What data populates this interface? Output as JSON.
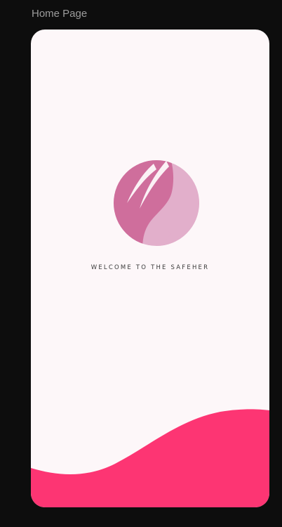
{
  "frame": {
    "title": "Home Page"
  },
  "screen": {
    "welcome_text": "WELCOME TO THE SAFEHER",
    "logo_icon": "woman-profile-icon",
    "background_color": "#fdf7f9",
    "accent_color": "#fd3573",
    "logo_colors": [
      "#cf6e9c",
      "#e2afcb"
    ]
  }
}
